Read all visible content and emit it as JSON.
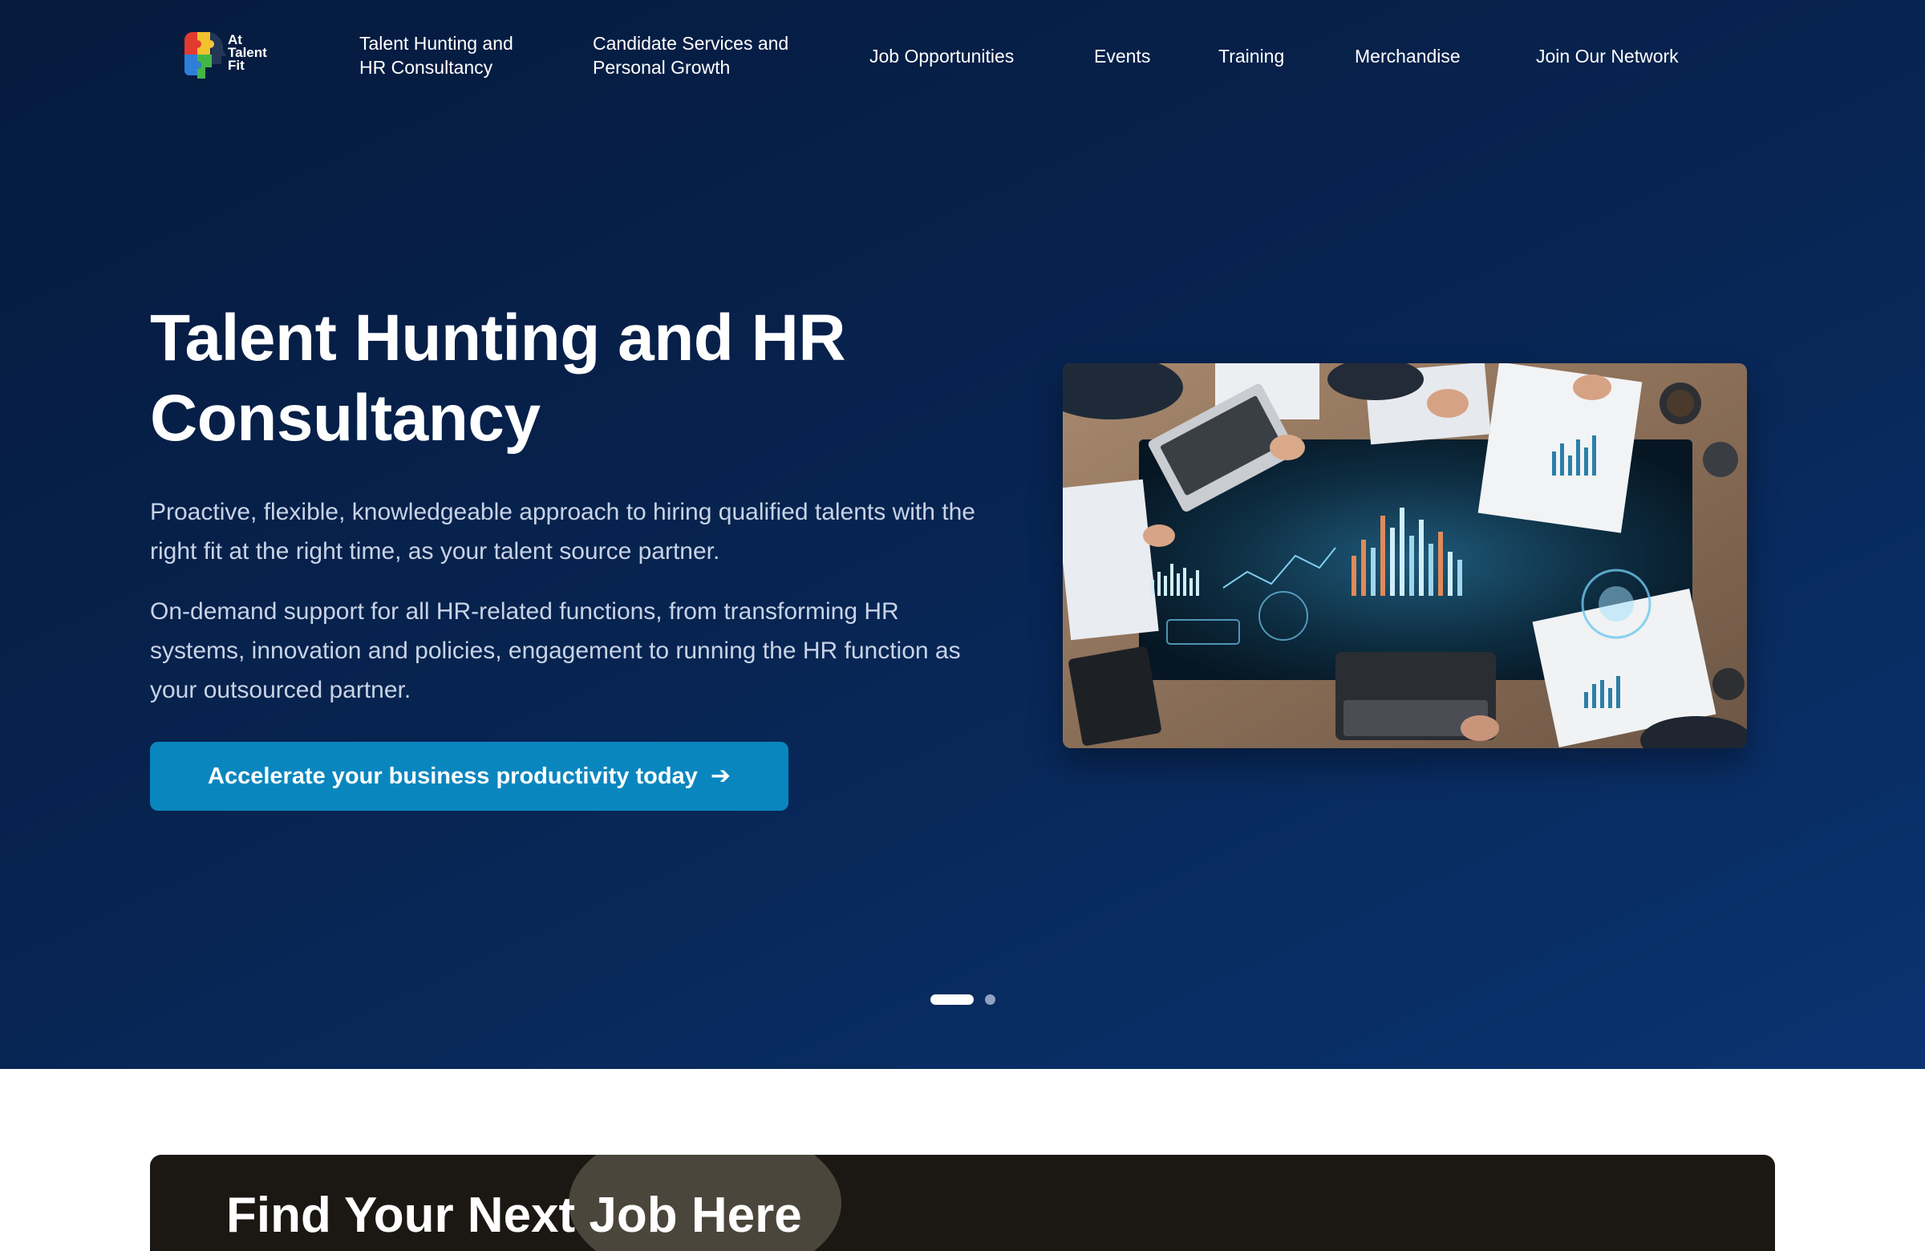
{
  "brand": {
    "logo_text": "At\nTalent\nFit",
    "colors": {
      "hero_bg": "#07234f",
      "accent": "#0a86bf",
      "text": "#ffffff",
      "muted_text": "#c8d3e6"
    }
  },
  "nav": {
    "items": [
      {
        "label": "Talent Hunting and\nHR Consultancy"
      },
      {
        "label": "Candidate Services and\nPersonal Growth"
      },
      {
        "label": "Job Opportunities"
      },
      {
        "label": "Events"
      },
      {
        "label": "Training"
      },
      {
        "label": "Merchandise"
      },
      {
        "label": "Join Our Network"
      }
    ]
  },
  "hero": {
    "title": "Talent Hunting and HR Consultancy",
    "paragraphs": [
      "Proactive, flexible, knowledgeable approach to hiring qualified talents with the right fit at the right time, as your talent source partner.",
      "On-demand support for all HR-related functions, from transforming HR systems, innovation and policies, engagement to running the HR function as your outsourced partner."
    ],
    "cta_label": "Accelerate your business productivity today",
    "cta_icon": "arrow-right-icon",
    "image": "business-analytics-meeting-photo",
    "carousel": {
      "slides": 2,
      "active": 1
    }
  },
  "next_section": {
    "title": "Find Your Next Job Here"
  }
}
